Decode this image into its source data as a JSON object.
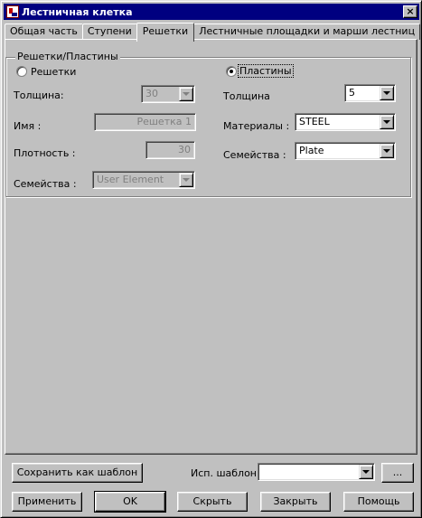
{
  "window": {
    "title": "Лестничная клетка",
    "close_glyph": "×"
  },
  "tabs": [
    {
      "label": "Общая часть"
    },
    {
      "label": "Ступени"
    },
    {
      "label": "Решетки"
    },
    {
      "label": "Лестничные площадки и марши лестниц"
    }
  ],
  "group": {
    "title": "Решетки/Пластины",
    "left": {
      "radio_label": "Решетки",
      "thickness_label": "Толщина:",
      "thickness_value": "30",
      "name_label": "Имя :",
      "name_value": "Решетка 1",
      "density_label": "Плотность :",
      "density_value": "30",
      "families_label": "Семейства :",
      "families_value": "User Element"
    },
    "right": {
      "radio_label": "Пластины",
      "thickness_label": "Толщина",
      "thickness_value": "5",
      "materials_label": "Материалы :",
      "materials_value": "STEEL",
      "families_label": "Семейства :",
      "families_value": "Plate"
    }
  },
  "footer": {
    "save_template_label": "Сохранить как шаблон",
    "use_template_label": "Исп. шаблон",
    "template_value": "",
    "browse_label": "...",
    "apply_label": "Применить",
    "ok_label": "OK",
    "hide_label": "Скрыть",
    "close_label": "Закрыть",
    "help_label": "Помощь"
  }
}
